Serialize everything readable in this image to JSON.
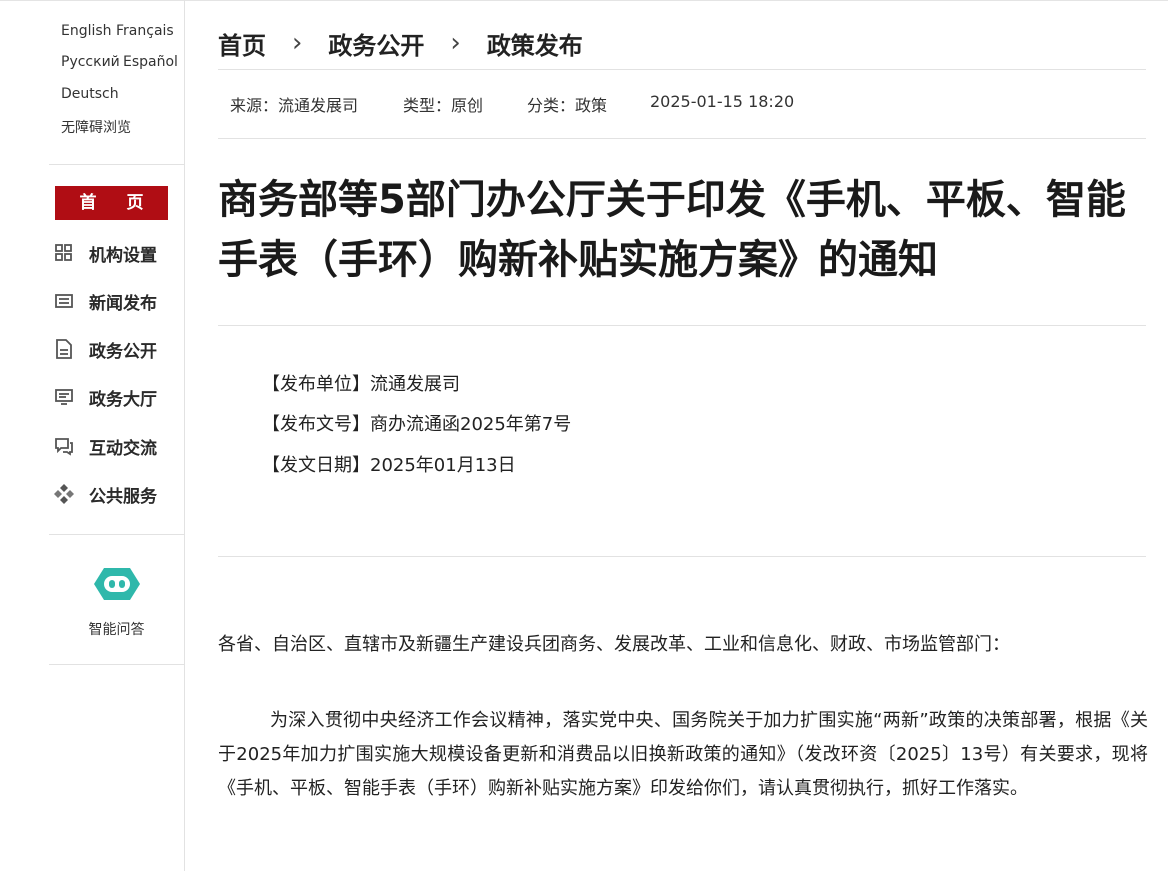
{
  "sidebar": {
    "languages": [
      "English",
      "Français",
      "Русский",
      "Español",
      "Deutsch"
    ],
    "accessible": "无障碍浏览",
    "home": "首 页",
    "nav": [
      {
        "label": "机构设置",
        "icon": "org-grid-icon"
      },
      {
        "label": "新闻发布",
        "icon": "news-icon"
      },
      {
        "label": "政务公开",
        "icon": "document-icon"
      },
      {
        "label": "政务大厅",
        "icon": "monitor-icon"
      },
      {
        "label": "互动交流",
        "icon": "chat-icon"
      },
      {
        "label": "公共服务",
        "icon": "service-icon"
      }
    ],
    "ai_assistant": "智能问答"
  },
  "breadcrumb": [
    "首页",
    "政务公开",
    "政策发布"
  ],
  "meta": {
    "source": "来源：流通发展司",
    "type": "类型：原创",
    "category": "分类：政策",
    "datetime": "2025-01-15 18:20"
  },
  "article": {
    "title": "商务部等5部门办公厅关于印发《手机、平板、智能手表（手环）购新补贴实施方案》的通知",
    "info": [
      "【发布单位】流通发展司",
      "【发布文号】商办流通函2025年第7号",
      "【发文日期】2025年01月13日"
    ],
    "greeting": "各省、自治区、直辖市及新疆生产建设兵团商务、发展改革、工业和信息化、财政、市场监管部门：",
    "paragraph": "为深入贯彻中央经济工作会议精神，落实党中央、国务院关于加力扩围实施“两新”政策的决策部署，根据《关于2025年加力扩围实施大规模设备更新和消费品以旧换新政策的通知》（发改环资〔2025〕13号）有关要求，现将《手机、平板、智能手表（手环）购新补贴实施方案》印发给你们，请认真贯彻执行，抓好工作落实。"
  },
  "colors": {
    "accent": "#b00d14",
    "ai": "#2fb8ab"
  }
}
